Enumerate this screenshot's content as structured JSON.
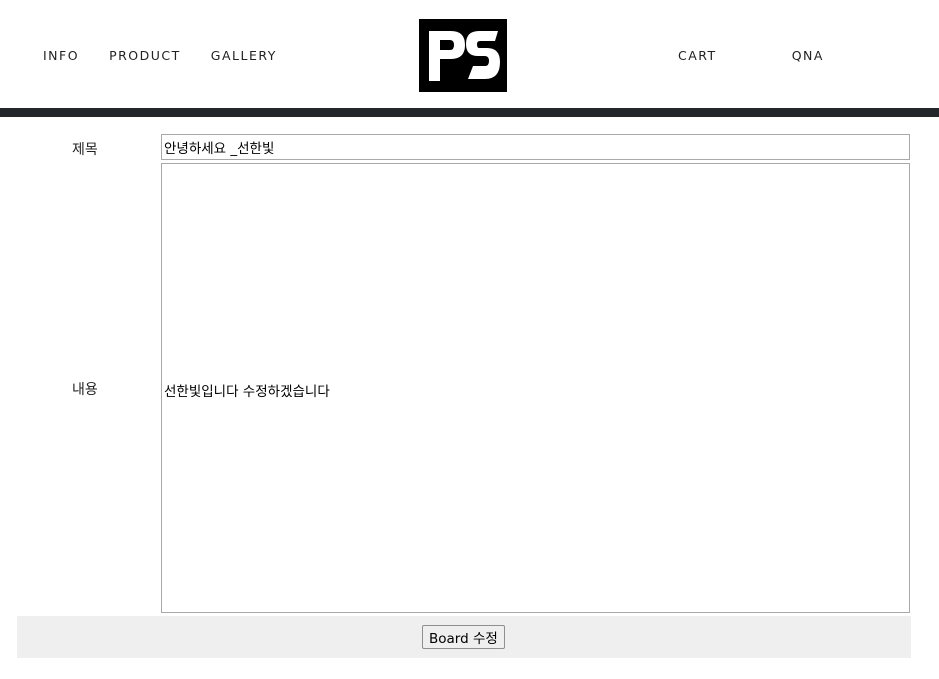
{
  "nav": {
    "left": [
      "INFO",
      "PRODUCT",
      "GALLERY"
    ],
    "right": [
      "CART",
      "QNA"
    ]
  },
  "logo": {
    "text": "PS",
    "icon": "ps-logo",
    "background": "#000000",
    "foreground": "#ffffff"
  },
  "header_bar_color": "#23262b",
  "form": {
    "title_label": "제목",
    "title_value": "안녕하세요 _선한빛",
    "content_label": "내용",
    "content_value": "선한빛입니다 수정하겠습니다",
    "submit_label": "Board 수정"
  }
}
